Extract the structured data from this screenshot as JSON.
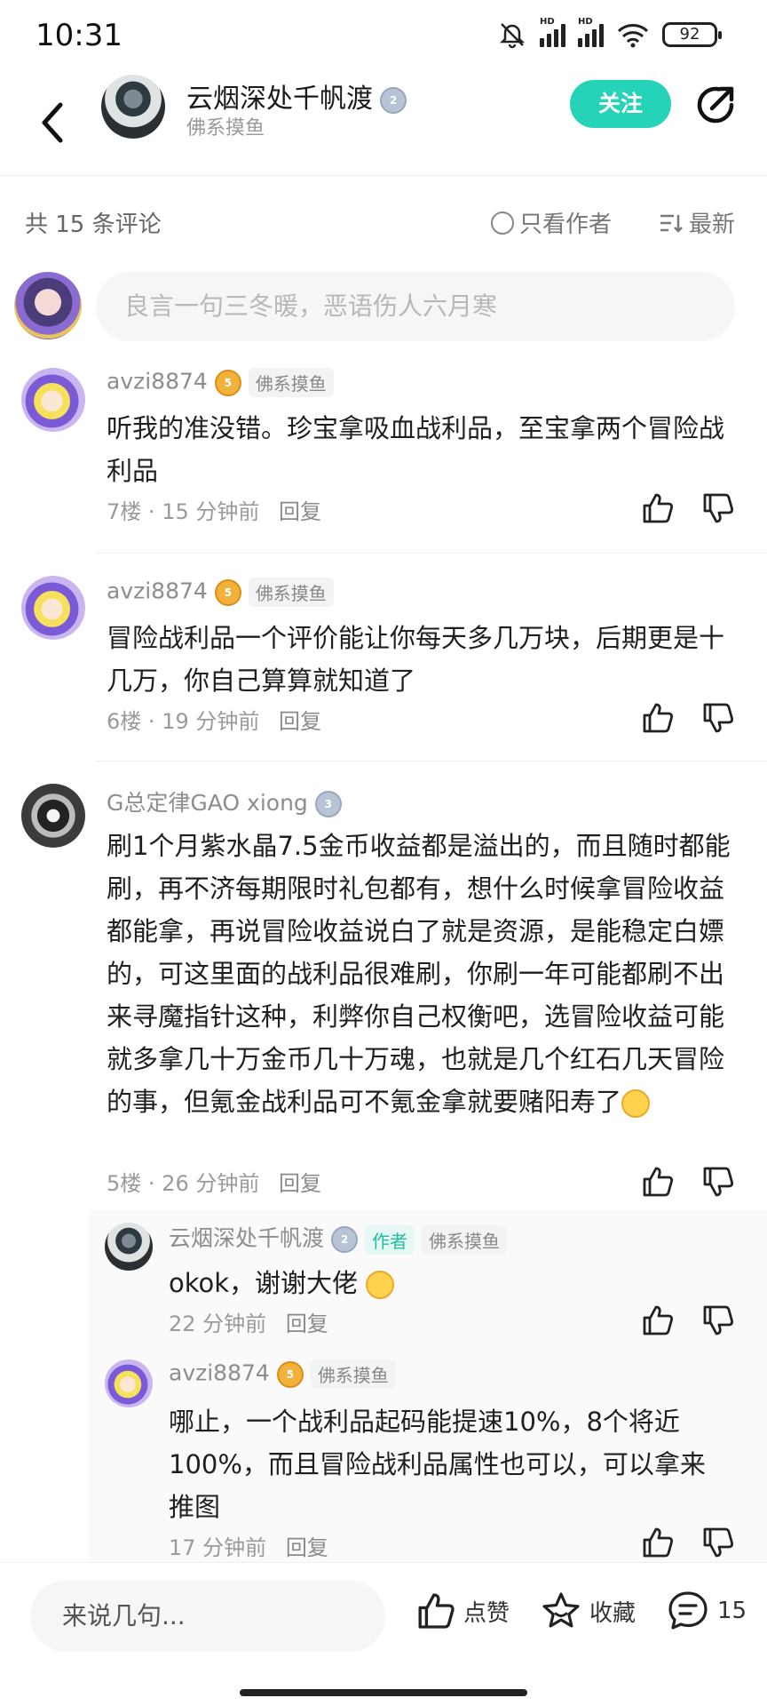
{
  "status_bar": {
    "time": "10:31",
    "battery": "92",
    "hd1": "HD",
    "hd2": "HD"
  },
  "header": {
    "name": "云烟深处千帆渡",
    "level": "2",
    "subtitle": "佛系摸鱼",
    "follow_label": "关注"
  },
  "toolbar": {
    "count": "共 15 条评论",
    "only_author": "只看作者",
    "sort": "最新"
  },
  "input": {
    "placeholder": "良言一句三冬暖，恶语伤人六月寒"
  },
  "comments": [
    {
      "username": "avzi8874",
      "level": "5",
      "tag": "佛系摸鱼",
      "text": "听我的准没错。珍宝拿吸血战利品，至宝拿两个冒险战利品",
      "floor": "7楼",
      "sep": "·",
      "time": "15 分钟前",
      "reply": "回复"
    },
    {
      "username": "avzi8874",
      "level": "5",
      "tag": "佛系摸鱼",
      "text": "冒险战利品一个评价能让你每天多几万块，后期更是十几万，你自己算算就知道了",
      "floor": "6楼",
      "sep": "·",
      "time": "19 分钟前",
      "reply": "回复"
    },
    {
      "username": "G总定律GAO xiong",
      "level": "3",
      "text": "刷1个月紫水晶7.5金币收益都是溢出的，而且随时都能刷，再不济每期限时礼包都有，想什么时候拿冒险收益都能拿，再说冒险收益说白了就是资源，是能稳定白嫖的，可这里面的战利品很难刷，你刷一年可能都刷不出来寻魔指针这种，利弊你自己权衡吧，选冒险收益可能就多拿几十万金币几十万魂，也就是几个红石几天冒险的事，但氪金战利品可不氪金拿就要赌阳寿了",
      "floor": "5楼",
      "sep": "·",
      "time": "26 分钟前",
      "reply": "回复"
    }
  ],
  "replies": [
    {
      "username": "云烟深处千帆渡",
      "level": "2",
      "author_tag": "作者",
      "tag": "佛系摸鱼",
      "text": "okok，谢谢大佬",
      "time": "22 分钟前",
      "reply": "回复"
    },
    {
      "username": "avzi8874",
      "level": "5",
      "tag": "佛系摸鱼",
      "text": "哪止，一个战利品起码能提速10%，8个将近100%，而且冒险战利品属性也可以，可以拿来推图",
      "time": "17 分钟前",
      "reply": "回复"
    }
  ],
  "bottom_bar": {
    "placeholder": "来说几句...",
    "like_label": "点赞",
    "fav_label": "收藏",
    "comment_count": "15"
  },
  "colors": {
    "accent": "#25d3b8",
    "text": "#1f1f1f",
    "muted": "#9a9a9a"
  }
}
